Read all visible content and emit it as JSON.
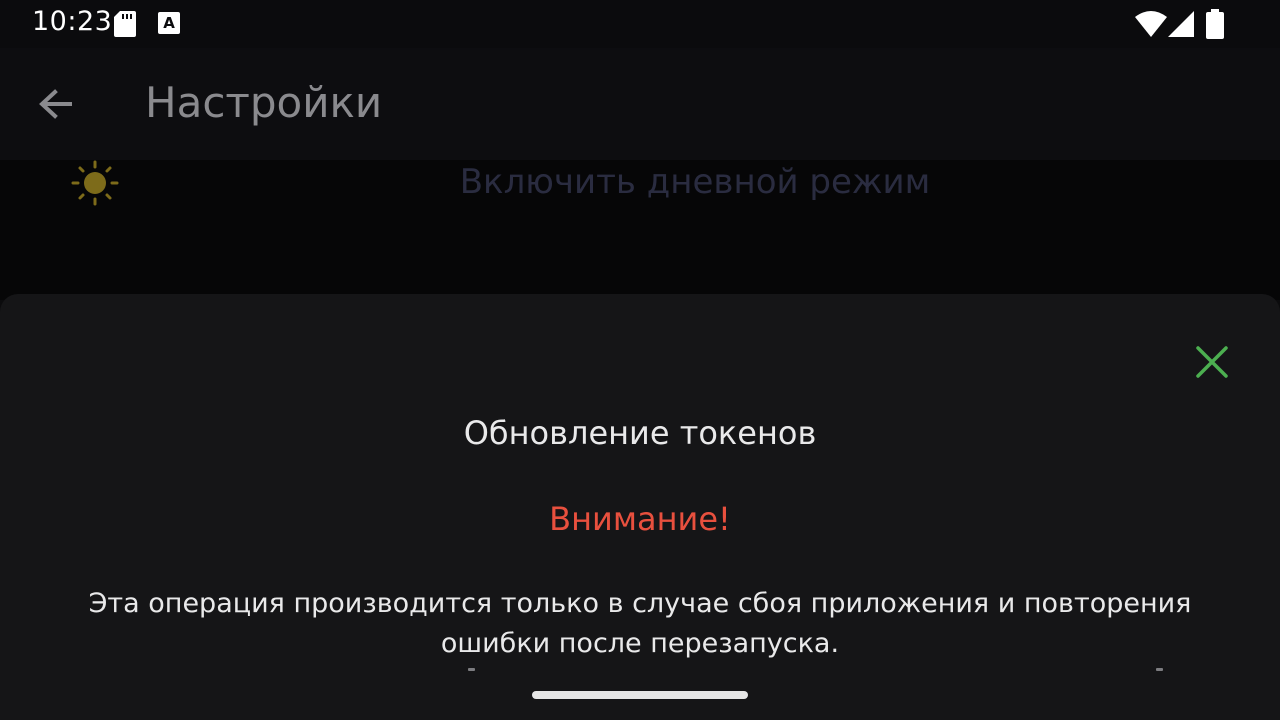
{
  "status_bar": {
    "time": "10:23",
    "icons": [
      "sd-card-icon",
      "a-notification-icon",
      "wifi-icon",
      "signal-icon",
      "battery-icon"
    ]
  },
  "app_bar": {
    "title": "Настройки",
    "back_icon": "arrow-left-icon"
  },
  "settings": {
    "day_mode_label": "Включить дневной режим",
    "day_mode_icon": "sun-icon",
    "sun_color": "#7d6b1a"
  },
  "sheet": {
    "title": "Обновление токенов",
    "warning_label": "Внимание!",
    "warning_text": "Эта операция производится только в случае сбоя приложения и повторения ошибки после перезапуска.",
    "close_icon": "close-icon",
    "close_color": "#4caf50",
    "warning_color": "#e8503e"
  }
}
